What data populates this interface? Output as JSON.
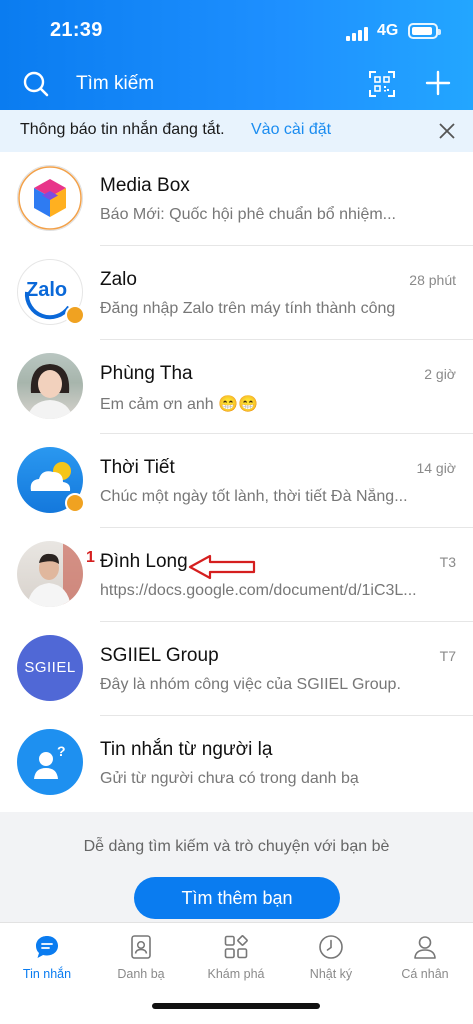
{
  "status": {
    "time": "21:39",
    "network": "4G",
    "battery_level": 0.9
  },
  "header": {
    "search_label": "Tìm kiếm",
    "icons": [
      "search-icon",
      "qr-scan-icon",
      "plus-icon"
    ]
  },
  "notice": {
    "text": "Thông báo tin nhắn đang tắt.",
    "link": "Vào cài đặt"
  },
  "conversations": [
    {
      "name": "Media Box",
      "preview": "Báo Mới: Quốc hội phê chuẩn bổ nhiệm...",
      "time": ""
    },
    {
      "name": "Zalo",
      "avatar_text": "Zalo",
      "preview": "Đăng nhập Zalo trên máy tính thành công",
      "time": "28 phút"
    },
    {
      "name": "Phùng Tha",
      "preview": "Em cảm ơn anh 😁😁",
      "time": "2 giờ"
    },
    {
      "name": "Thời Tiết",
      "preview": "Chúc một ngày tốt lành, thời tiết Đà Nẵng...",
      "time": "14 giờ"
    },
    {
      "name": "Đình Long",
      "preview": "https://docs.google.com/document/d/1iC3L...",
      "time": "T3"
    },
    {
      "name": "SGIIEL Group",
      "avatar_text": "SGIIEL",
      "preview": "Đây là nhóm công việc của SGIIEL Group.",
      "time": "T7"
    },
    {
      "name": "Tin nhắn từ người lạ",
      "preview": "Gửi từ người chưa có trong danh bạ",
      "time": ""
    }
  ],
  "annotation": {
    "number": "1"
  },
  "promo": {
    "text": "Dễ dàng tìm kiếm và trò chuyện với bạn bè",
    "button": "Tìm thêm bạn"
  },
  "tabs": [
    {
      "label": "Tin nhắn",
      "icon": "chat-icon",
      "active": true
    },
    {
      "label": "Danh bạ",
      "icon": "contacts-icon",
      "active": false
    },
    {
      "label": "Khám phá",
      "icon": "explore-grid-icon",
      "active": false
    },
    {
      "label": "Nhật ký",
      "icon": "clock-icon",
      "active": false
    },
    {
      "label": "Cá nhân",
      "icon": "person-icon",
      "active": false
    }
  ],
  "colors": {
    "brand": "#0a7cf0",
    "annotation": "#d51f1f",
    "verified": "#f0a221"
  }
}
